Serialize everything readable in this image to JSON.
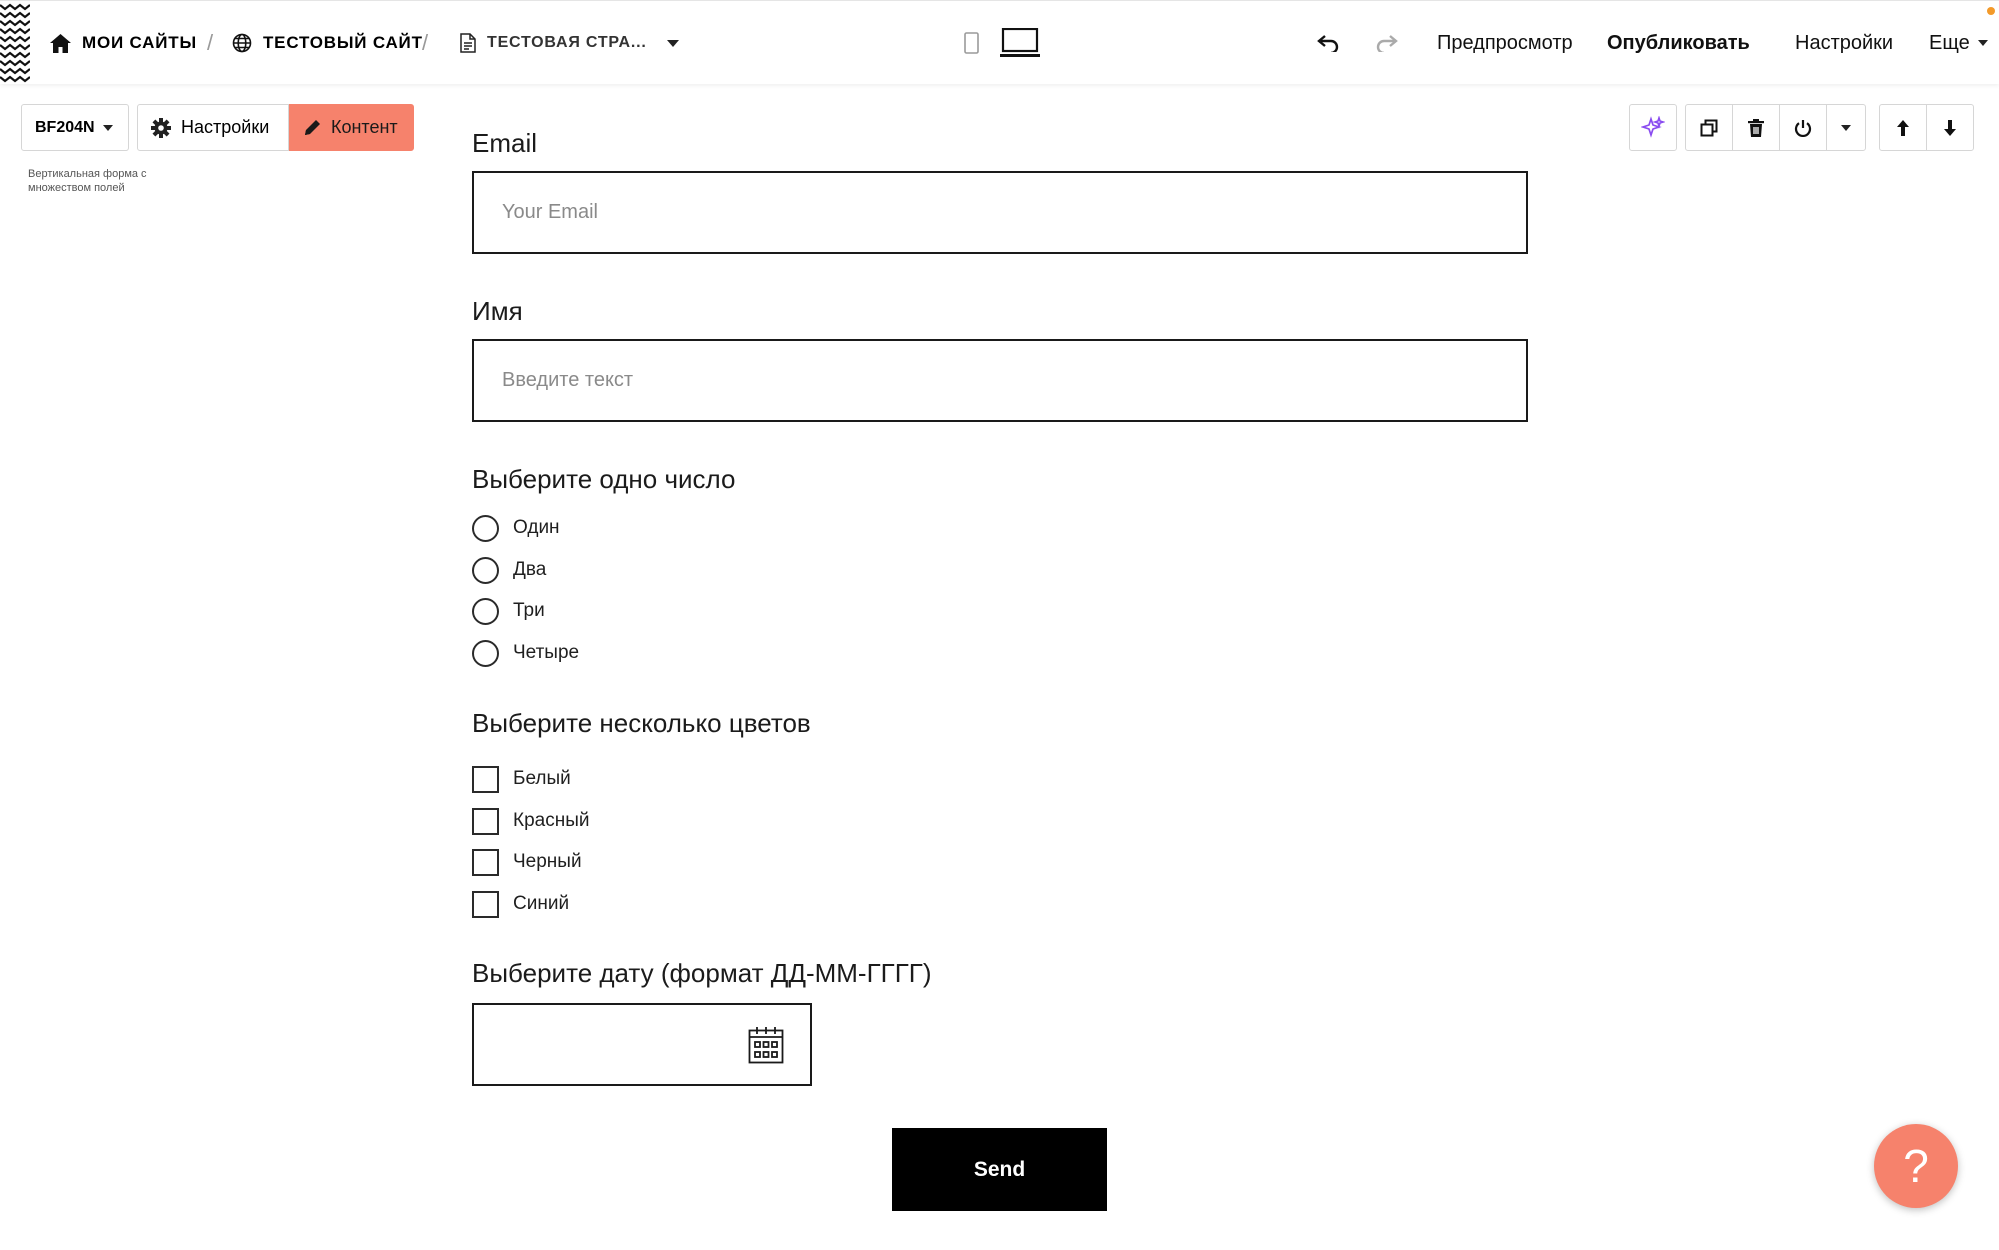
{
  "topbar": {
    "breadcrumbs": [
      {
        "label": "МОИ САЙТЫ",
        "icon": "home-icon"
      },
      {
        "label": "ТЕСТОВЫЙ САЙТ",
        "icon": "globe-icon"
      },
      {
        "label": "ТЕСТОВАЯ СТРА...",
        "icon": "page-icon"
      }
    ],
    "separator": "/",
    "device_modes": [
      "mobile-icon",
      "desktop-icon"
    ],
    "active_device": "desktop",
    "preview_label": "Предпросмотр",
    "publish_label": "Опубликовать",
    "settings_label": "Настройки",
    "more_label": "Еще"
  },
  "block_toolbar": {
    "code": "BF204N",
    "settings_label": "Настройки",
    "content_label": "Контент",
    "description": "Вертикальная форма с множеством полей"
  },
  "right_toolbar": {
    "icons": [
      "sparkle-icon",
      "duplicate-icon",
      "trash-icon",
      "power-icon",
      "caret-down-icon",
      "arrow-up-icon",
      "arrow-down-icon"
    ]
  },
  "form": {
    "email": {
      "label": "Email",
      "placeholder": "Your Email",
      "value": ""
    },
    "name": {
      "label": "Имя",
      "placeholder": "Введите текст",
      "value": ""
    },
    "radio_group": {
      "label": "Выберите одно число",
      "options": [
        "Один",
        "Два",
        "Три",
        "Четыре"
      ],
      "selected": null
    },
    "checkbox_group": {
      "label": "Выберите несколько цветов",
      "options": [
        "Белый",
        "Красный",
        "Черный",
        "Синий"
      ],
      "checked": []
    },
    "date": {
      "label": "Выберите дату (формат ДД-ММ-ГГГГ)",
      "value": ""
    },
    "submit_label": "Send"
  },
  "help": {
    "label": "?"
  },
  "colors": {
    "accent": "#f6826c",
    "sparkle": "#8a4cf0",
    "notification": "#f39a2a",
    "submit_bg": "#000000"
  }
}
